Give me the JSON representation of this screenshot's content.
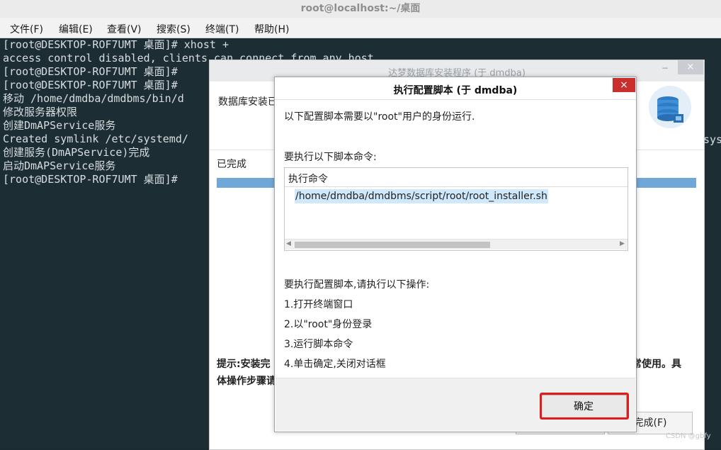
{
  "terminal": {
    "title": "root@localhost:~/桌面",
    "menu": [
      "文件(F)",
      "编辑(E)",
      "查看(V)",
      "搜索(S)",
      "终端(T)",
      "帮助(H)"
    ],
    "lines": [
      "[root@DESKTOP-ROF7UMT 桌面]# xhost +",
      "access control disabled, clients can connect from any host",
      "[root@DESKTOP-ROF7UMT 桌面]#",
      "[root@DESKTOP-ROF7UMT 桌面]#",
      "移动 /home/dmdba/dmdbms/bin/d",
      "修改服务器权限",
      "创建DmAPService服务",
      "Created symlink /etc/systemd/",
      "创建服务(DmAPService)完成",
      "启动DmAPService服务",
      "[root@DESKTOP-ROF7UMT 桌面]#"
    ],
    "side_fragment": "sys"
  },
  "installer": {
    "title": "达梦数据库安装程序 (于 dmdba)",
    "minimize_icon": "−",
    "close_icon": "×",
    "heading": "数据库安装已",
    "status": "已完成",
    "progress_percent": 100,
    "hint_line1": "提示:安装完",
    "hint_tail": "常使用。具",
    "hint_line2": "体操作步骤请",
    "finish_button": "完成(F)"
  },
  "dialog": {
    "title": "执行配置脚本 (于 dmdba)",
    "close_icon": "×",
    "intro": "以下配置脚本需要以\"root\"用户的身份运行.",
    "commands_label": "要执行以下脚本命令:",
    "table_header": "执行命令",
    "commands": [
      "/home/dmdba/dmdbms/script/root/root_installer.sh"
    ],
    "steps_label": "要执行配置脚本,请执行以下操作:",
    "steps": [
      "1.打开终端窗口",
      "2.以\"root\"身份登录",
      "3.运行脚本命令",
      "4.单击确定,关闭对话框"
    ],
    "ok_button": "确定"
  },
  "watermark": "CSDN @gbfy"
}
